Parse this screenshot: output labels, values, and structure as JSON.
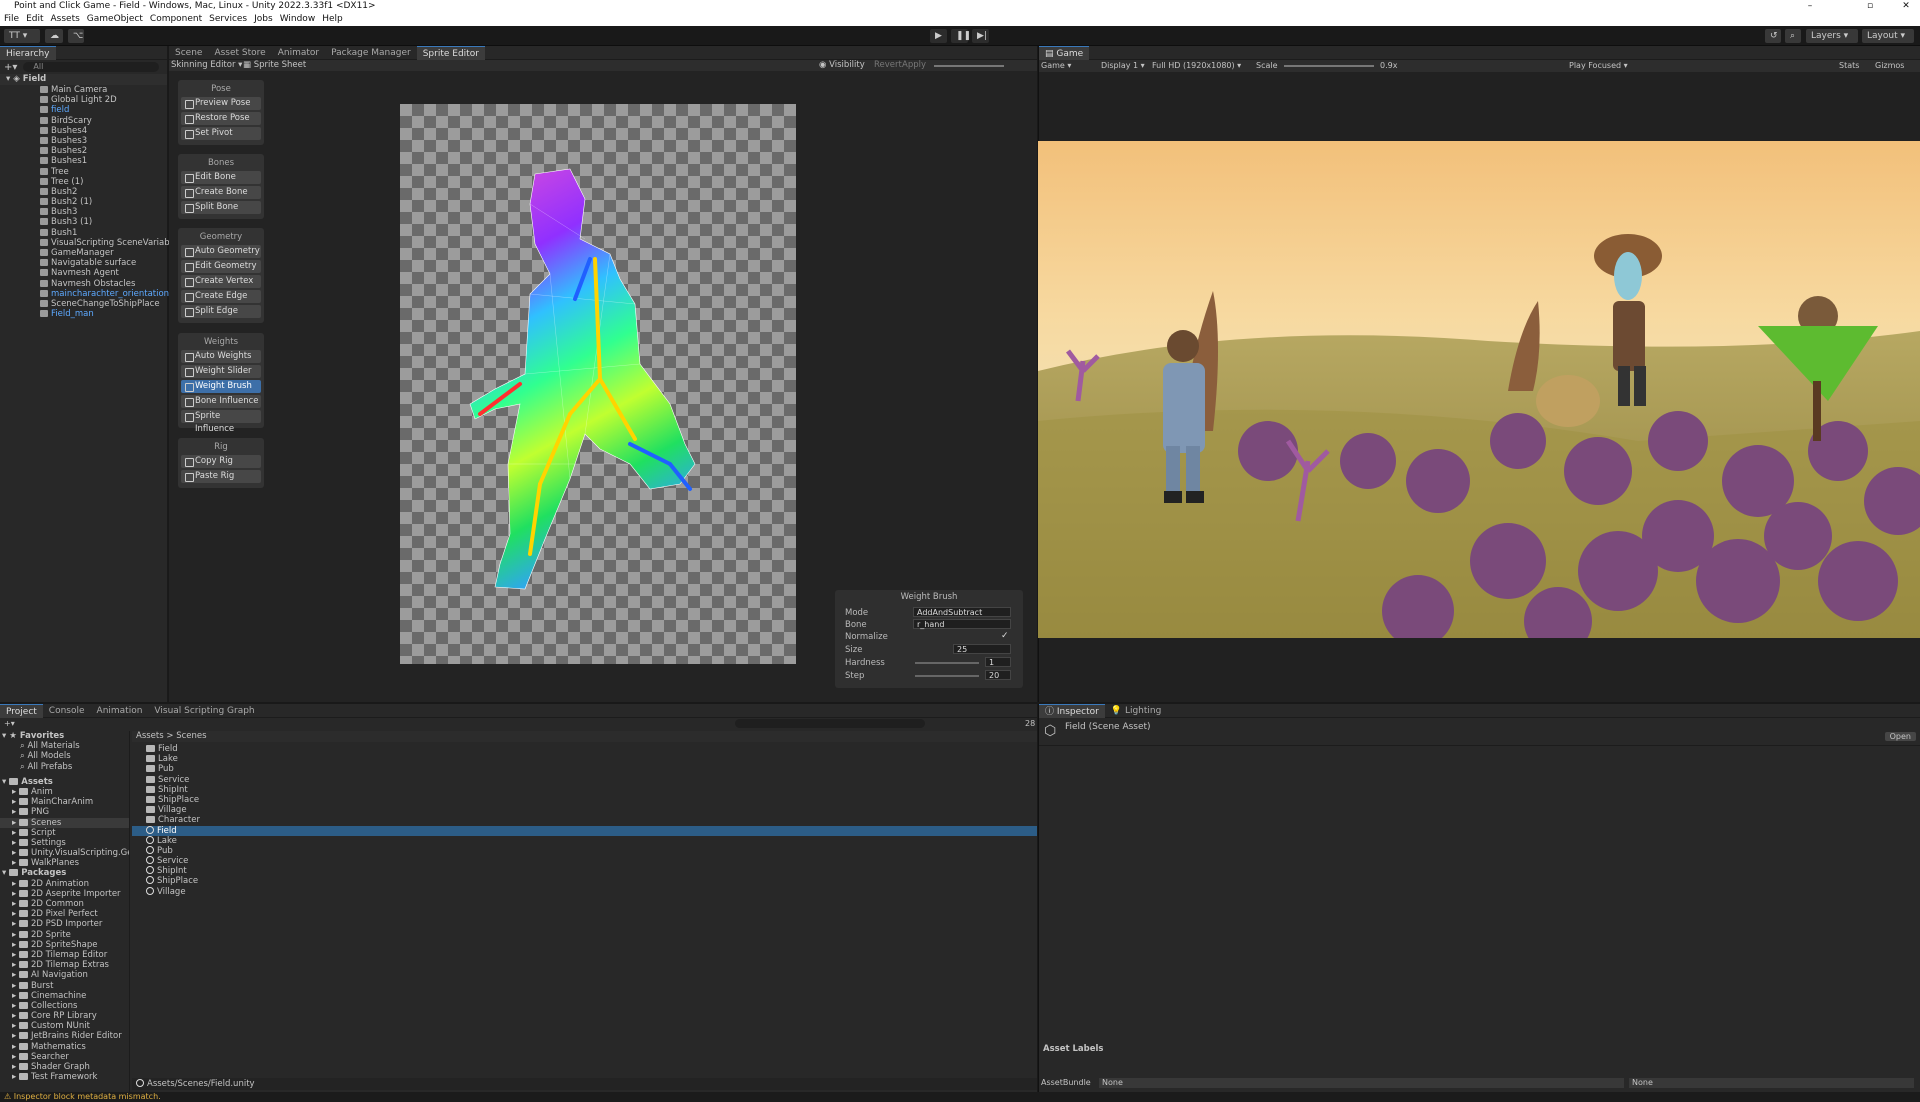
{
  "window": {
    "title": "Point and Click Game - Field - Windows, Mac, Linux - Unity 2022.3.33f1 <DX11>"
  },
  "menu": [
    "File",
    "Edit",
    "Assets",
    "GameObject",
    "Component",
    "Services",
    "Jobs",
    "Window",
    "Help"
  ],
  "toolbar": {
    "account": "TT",
    "layers": "Layers",
    "layout": "Layout"
  },
  "hierarchy": {
    "tab": "Hierarchy",
    "search": "All",
    "scene": "Field",
    "items": [
      {
        "label": "Main Camera",
        "blue": false
      },
      {
        "label": "Global Light 2D",
        "blue": false
      },
      {
        "label": "field",
        "blue": true
      },
      {
        "label": "BirdScary",
        "blue": false
      },
      {
        "label": "Bushes4",
        "blue": false
      },
      {
        "label": "Bushes3",
        "blue": false
      },
      {
        "label": "Bushes2",
        "blue": false
      },
      {
        "label": "Bushes1",
        "blue": false
      },
      {
        "label": "Tree",
        "blue": false
      },
      {
        "label": "Tree (1)",
        "blue": false
      },
      {
        "label": "Bush2",
        "blue": false
      },
      {
        "label": "Bush2 (1)",
        "blue": false
      },
      {
        "label": "Bush3",
        "blue": false
      },
      {
        "label": "Bush3 (1)",
        "blue": false
      },
      {
        "label": "Bush1",
        "blue": false
      },
      {
        "label": "VisualScripting SceneVariables",
        "blue": false
      },
      {
        "label": "GameManager",
        "blue": false
      },
      {
        "label": "Navigatable surface",
        "blue": false
      },
      {
        "label": "Navmesh Agent",
        "blue": false
      },
      {
        "label": "Navmesh Obstacles",
        "blue": false
      },
      {
        "label": "maincharachter_orientations",
        "blue": true
      },
      {
        "label": "SceneChangeToShipPlace",
        "blue": false
      },
      {
        "label": "Field_man",
        "blue": true
      }
    ]
  },
  "center_tabs": [
    "Scene",
    "Asset Store",
    "Animator",
    "Package Manager",
    "Sprite Editor"
  ],
  "sprite_toolbar": {
    "mode": "Skinning Editor",
    "sprite_sheet": "Sprite Sheet",
    "visibility": "Visibility",
    "revert": "Revert",
    "apply": "Apply"
  },
  "tool_groups": [
    {
      "title": "Pose",
      "items": [
        "Preview Pose",
        "Restore Pose",
        "Set Pivot"
      ]
    },
    {
      "title": "Bones",
      "items": [
        "Edit Bone",
        "Create Bone",
        "Split Bone"
      ]
    },
    {
      "title": "Geometry",
      "items": [
        "Auto Geometry",
        "Edit Geometry",
        "Create Vertex",
        "Create Edge",
        "Split Edge"
      ]
    },
    {
      "title": "Weights",
      "items": [
        "Auto Weights",
        "Weight Slider",
        "Weight Brush",
        "Bone Influence",
        "Sprite Influence"
      ]
    },
    {
      "title": "Rig",
      "items": [
        "Copy Rig",
        "Paste Rig"
      ]
    }
  ],
  "selected_tool": "Weight Brush",
  "weight_brush": {
    "title": "Weight Brush",
    "mode_label": "Mode",
    "mode": "AddAndSubtract",
    "bone_label": "Bone",
    "bone": "r_hand",
    "normalize_label": "Normalize",
    "normalize": true,
    "size_label": "Size",
    "size": "25",
    "hardness_label": "Hardness",
    "hardness": "1",
    "step_label": "Step",
    "step": "20"
  },
  "game": {
    "tab": "Game",
    "view": "Game",
    "display": "Display 1",
    "resolution": "Full HD (1920x1080)",
    "scale_label": "Scale",
    "scale": "0.9x",
    "play_focused": "Play Focused",
    "stats": "Stats",
    "gizmos": "Gizmos"
  },
  "bottom_tabs": [
    "Project",
    "Console",
    "Animation",
    "Visual Scripting Graph"
  ],
  "project": {
    "favorites_label": "Favorites",
    "favorites": [
      "All Materials",
      "All Models",
      "All Prefabs"
    ],
    "assets_label": "Assets",
    "assets": [
      "Anim",
      "MainCharAnim",
      "PNG",
      "Scenes",
      "Script",
      "Settings",
      "Unity.VisualScripting.Gen",
      "WalkPlanes"
    ],
    "packages_label": "Packages",
    "packages": [
      "2D Animation",
      "2D Aseprite Importer",
      "2D Common",
      "2D Pixel Perfect",
      "2D PSD Importer",
      "2D Sprite",
      "2D SpriteShape",
      "2D Tilemap Editor",
      "2D Tilemap Extras",
      "AI Navigation",
      "Burst",
      "Cinemachine",
      "Collections",
      "Core RP Library",
      "Custom NUnit",
      "JetBrains Rider Editor",
      "Mathematics",
      "Searcher",
      "Shader Graph",
      "Test Framework"
    ],
    "breadcrumb": [
      "Assets",
      "Scenes"
    ],
    "folders": [
      "Field",
      "Lake",
      "Pub",
      "Service",
      "ShipInt",
      "ShipPlace",
      "Village",
      "Character"
    ],
    "scenes": [
      "Field",
      "Lake",
      "Pub",
      "Service",
      "ShipInt",
      "ShipPlace",
      "Village"
    ],
    "selected_scene": "Field",
    "path": "Assets/Scenes/Field.unity",
    "count": "28"
  },
  "inspector": {
    "tabs": [
      "Inspector",
      "Lighting"
    ],
    "title": "Field (Scene Asset)",
    "open": "Open",
    "asset_labels": "Asset Labels",
    "assetbundle_label": "AssetBundle",
    "assetbundle": "None",
    "variant": "None"
  },
  "status": "Inspector block metadata mismatch."
}
